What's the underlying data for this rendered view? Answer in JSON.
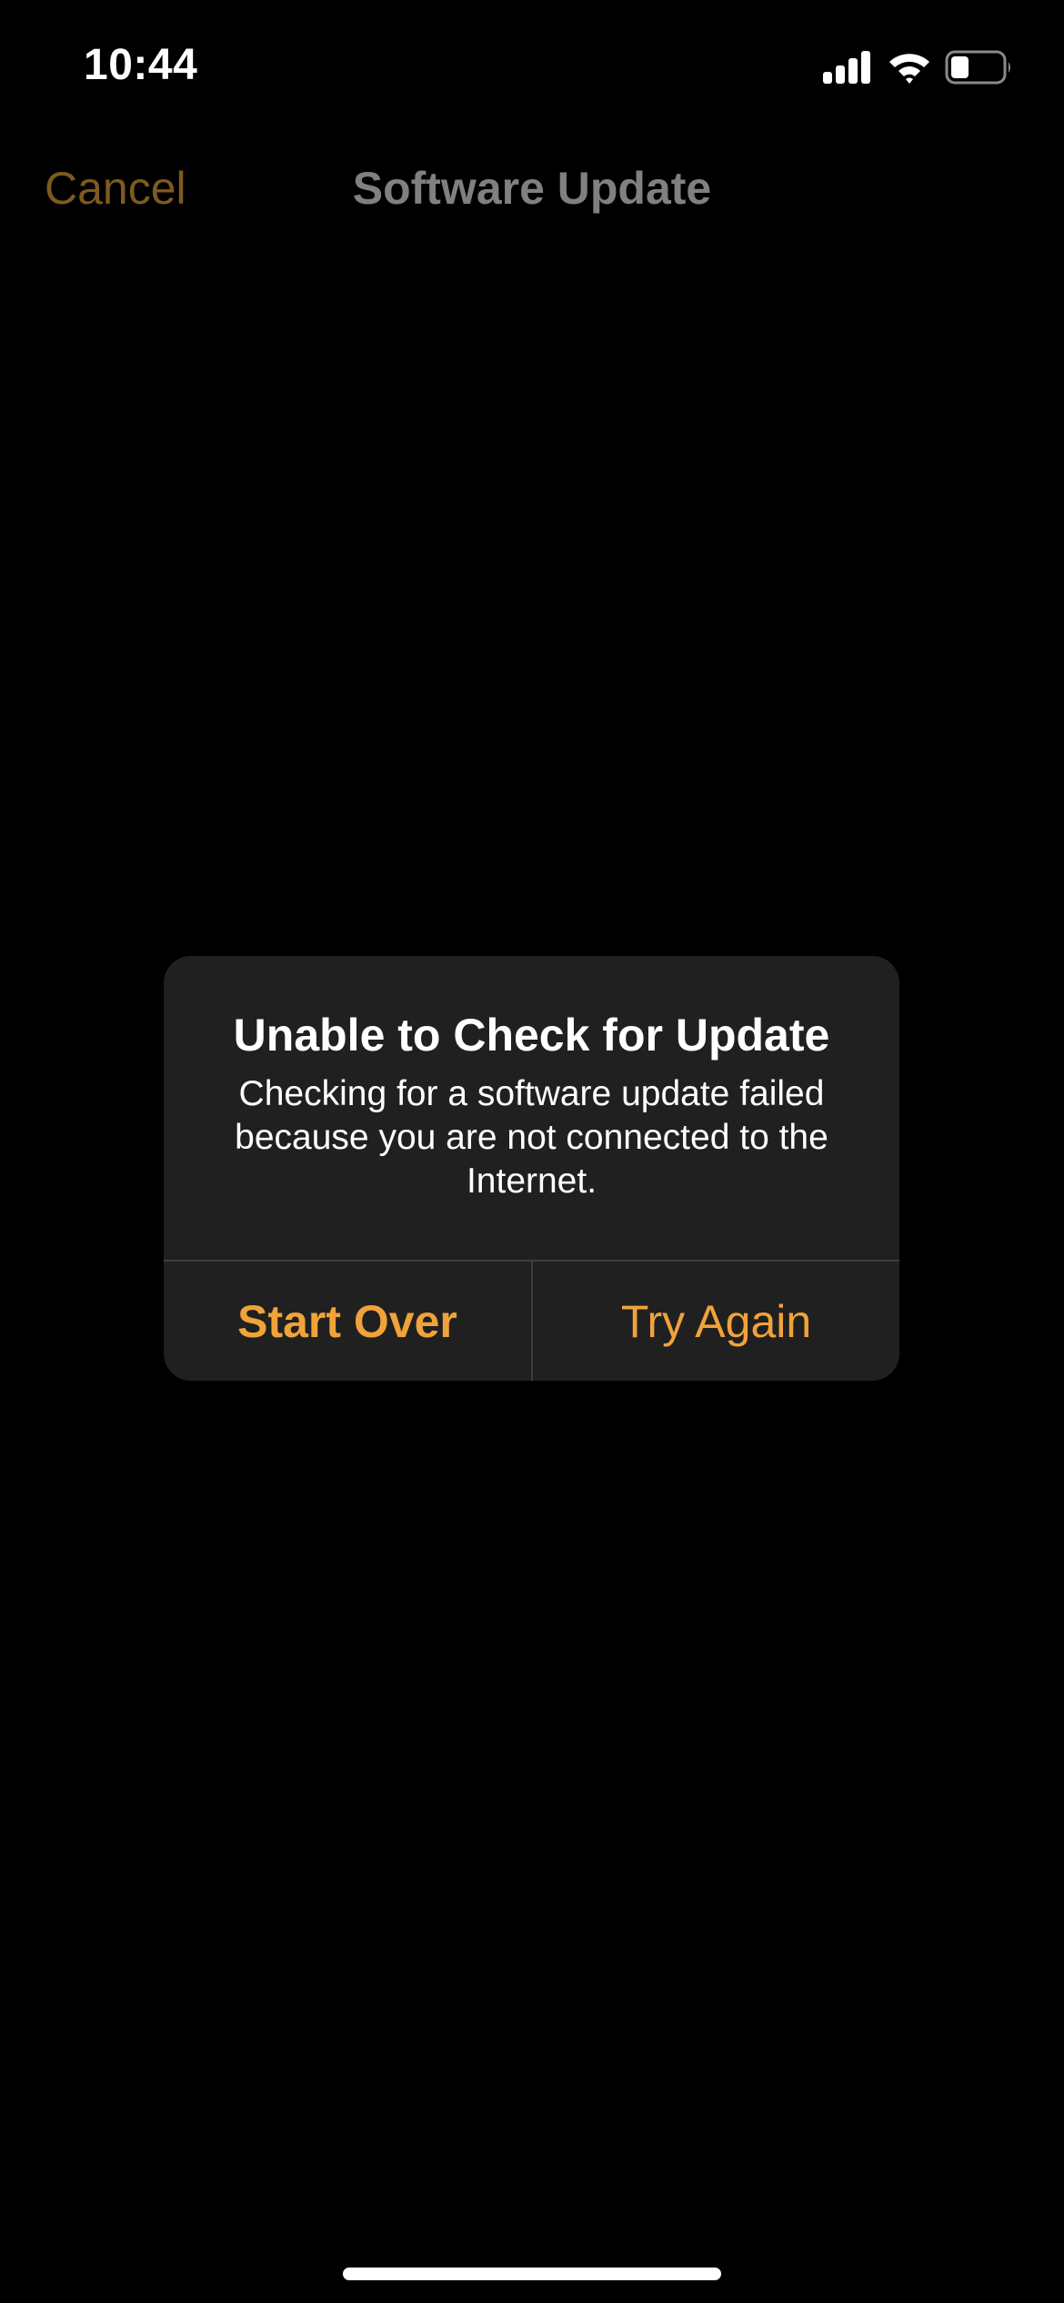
{
  "status_bar": {
    "time": "10:44",
    "icons": [
      "cellular-signal-icon",
      "wifi-icon",
      "battery-icon"
    ],
    "battery_level_fraction": 0.35
  },
  "nav": {
    "cancel_label": "Cancel",
    "title": "Software Update"
  },
  "alert": {
    "title": "Unable to Check for Update",
    "message": "Checking for a software update failed because you are not connected to the Internet.",
    "buttons": [
      {
        "label": "Start Over",
        "style": "bold"
      },
      {
        "label": "Try Again",
        "style": "regular"
      }
    ]
  },
  "colors": {
    "accent": "#f0a33a",
    "accent_dimmed": "#7e5a20",
    "title_dimmed": "#808080",
    "alert_background": "#202020",
    "background": "#000000"
  }
}
